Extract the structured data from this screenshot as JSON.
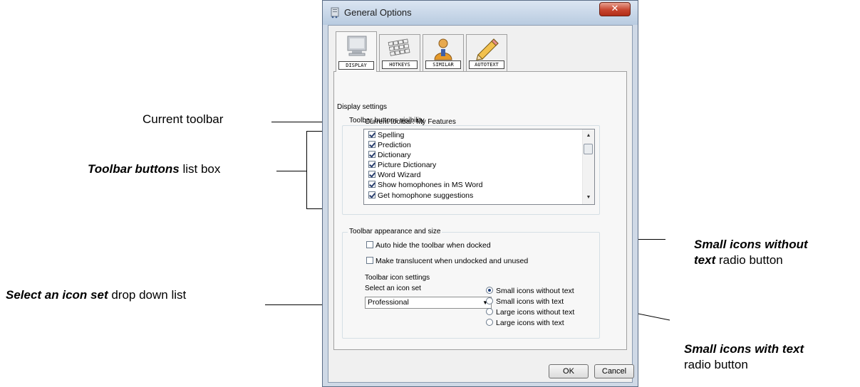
{
  "window": {
    "title": "General Options",
    "close_glyph": "✕"
  },
  "tabs": [
    {
      "label": "DISPLAY",
      "icon": "monitor-icon"
    },
    {
      "label": "HOTKEYS",
      "icon": "keyboard-icon"
    },
    {
      "label": "SIMILAR",
      "icon": "person-icon"
    },
    {
      "label": "AUTOTEXT",
      "icon": "pencil-icon"
    }
  ],
  "display": {
    "section_title": "Display settings",
    "visibility_group": "Toolbar buttons visibility",
    "current_toolbar_label": "Current toolbar: My Features",
    "toolbar_buttons": [
      {
        "label": "Spelling",
        "checked": true
      },
      {
        "label": "Prediction",
        "checked": true
      },
      {
        "label": "Dictionary",
        "checked": true
      },
      {
        "label": "Picture Dictionary",
        "checked": true
      },
      {
        "label": "Word Wizard",
        "checked": true
      },
      {
        "label": "Show homophones in MS Word",
        "checked": true
      },
      {
        "label": "Get homophone suggestions",
        "checked": true
      }
    ],
    "appearance_group": "Toolbar appearance and size",
    "auto_hide_label": "Auto hide the toolbar when docked",
    "translucent_label": "Make translucent when undocked and unused",
    "icon_settings_label": "Toolbar icon settings",
    "icon_set_label": "Select an icon set",
    "icon_set_value": "Professional",
    "radio_options": [
      {
        "label": "Small icons without text",
        "selected": true
      },
      {
        "label": "Small icons with text",
        "selected": false
      },
      {
        "label": "Large icons without text",
        "selected": false
      },
      {
        "label": "Large icons with text",
        "selected": false
      }
    ]
  },
  "buttons": {
    "ok": "OK",
    "cancel": "Cancel"
  },
  "callouts": {
    "current_toolbar": "Current toolbar",
    "toolbar_buttons_bold": "Toolbar buttons",
    "toolbar_buttons_rest": " list box",
    "icon_set_bold": "Select an icon set",
    "icon_set_rest": " drop down list",
    "small_without_bold_1": "Small icons without",
    "small_without_bold_2": "text",
    "small_without_rest": " radio button",
    "small_with_bold": "Small icons with text",
    "small_with_rest": "radio button"
  }
}
